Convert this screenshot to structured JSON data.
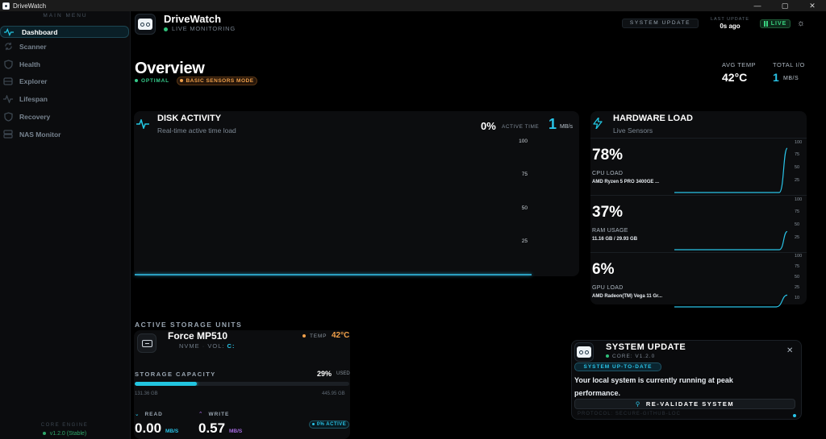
{
  "window": {
    "title": "DriveWatch",
    "controls": [
      "—",
      "▢",
      "✕"
    ]
  },
  "sidebar": {
    "header": "MAIN MENU",
    "items": [
      {
        "label": "Dashboard",
        "icon": "pulse-icon",
        "active": true
      },
      {
        "label": "Scanner",
        "icon": "refresh-icon",
        "active": false
      },
      {
        "label": "Health",
        "icon": "shield-icon",
        "active": false
      },
      {
        "label": "Explorer",
        "icon": "drive-icon",
        "active": false
      },
      {
        "label": "Lifespan",
        "icon": "activity-icon",
        "active": false
      },
      {
        "label": "Recovery",
        "icon": "shield-icon",
        "active": false
      },
      {
        "label": "NAS Monitor",
        "icon": "server-icon",
        "active": false
      }
    ],
    "core_engine_label": "CORE ENGINE",
    "core_engine_version": "v1.2.0 (Stable)"
  },
  "header": {
    "app_name": "DriveWatch",
    "status": "LIVE MONITORING",
    "system_update_button": "SYSTEM UPDATE",
    "last_update_label": "LAST UPDATE",
    "last_update_value": "0s ago",
    "live_badge": "LIVE"
  },
  "overview": {
    "title": "Overview",
    "status_badge": "OPTIMAL",
    "mode_badge": "BASIC SENSORS MODE",
    "avg_temp_label": "AVG TEMP",
    "avg_temp_value": "42°C",
    "total_io_label": "TOTAL I/O",
    "total_io_value": "1",
    "total_io_unit": "MB/S"
  },
  "disk_activity": {
    "title": "DISK ACTIVITY",
    "subtitle": "Real-time active time load",
    "active_pct": "0%",
    "active_label": "ACTIVE TIME",
    "rate": "1",
    "rate_unit": "MB/s",
    "y_ticks": [
      "100",
      "75",
      "50",
      "25"
    ],
    "ylim": [
      0,
      100
    ],
    "values": [
      0,
      0,
      0,
      0,
      0,
      0,
      0,
      0,
      0,
      0
    ]
  },
  "hardware_load": {
    "title": "HARDWARE LOAD",
    "subtitle": "Live Sensors",
    "rows": [
      {
        "value": "78%",
        "label": "CPU LOAD",
        "device": "AMD Ryzen 5 PRO 3400GE ...",
        "pct": 78,
        "ticks": [
          "100",
          "75",
          "50",
          "25"
        ]
      },
      {
        "value": "37%",
        "label": "RAM USAGE",
        "device": "11.16 GB / 29.93 GB",
        "pct": 37,
        "ticks": [
          "100",
          "75",
          "50",
          "25"
        ]
      },
      {
        "value": "6%",
        "label": "GPU LOAD",
        "device": "AMD Radeon(TM) Vega 11 Gr...",
        "pct": 6,
        "ticks": [
          "100",
          "75",
          "50",
          "25",
          "10"
        ]
      }
    ]
  },
  "storage": {
    "section_label": "ACTIVE STORAGE UNITS",
    "drive_name": "Force MP510",
    "drive_type": "NVME",
    "vol_label": "VOL:",
    "vol_value": "C:",
    "temp_label": "TEMP",
    "temp_value": "42°C",
    "capacity_label": "STORAGE CAPACITY",
    "capacity_pct": "29%",
    "capacity_used_label": "USED",
    "capacity_fraction": 0.29,
    "used_size": "131.36 GB",
    "total_size": "445.95 GB",
    "read_label": "READ",
    "read_value": "0.00",
    "read_unit": "MB/S",
    "write_label": "WRITE",
    "write_value": "0.57",
    "write_unit": "MB/S",
    "active_badge": "0% ACTIVE"
  },
  "update_popup": {
    "title": "SYSTEM UPDATE",
    "core": "CORE: V1.2.0",
    "status": "SYSTEM UP-TO-DATE",
    "message": "Your local system is currently running at peak performance.",
    "button": "RE-VALIDATE SYSTEM",
    "protocol": "PROTOCOL: SECURE-GITHUB-LOC"
  },
  "colors": {
    "accent": "#22c5e0",
    "success": "#2fc07a",
    "warning": "#f0a04a"
  }
}
